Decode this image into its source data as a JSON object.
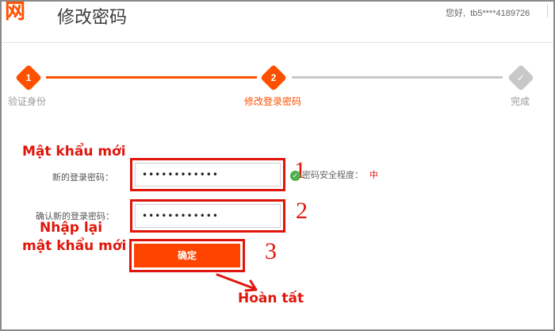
{
  "header": {
    "logo": "网",
    "title": "修改密码",
    "greeting": "您好,",
    "username": "tb5****4189726"
  },
  "steps": [
    {
      "number": "1",
      "label": "验证身份",
      "state": "done"
    },
    {
      "number": "2",
      "label": "修改登录密码",
      "state": "active"
    },
    {
      "number": "✓",
      "label": "完成",
      "state": "pending"
    }
  ],
  "form": {
    "new_password_label": "新的登录密码：",
    "new_password_value": "••••••••••••",
    "confirm_password_label": "确认新的登录密码：",
    "confirm_password_value": "••••••••••••",
    "strength_label": "密码安全程度：",
    "strength_level": "中",
    "submit_label": "确定"
  },
  "annotations": {
    "new_password": "Mật khẩu mới",
    "reenter_line1": "Nhập lại",
    "reenter_line2": "mật khẩu mới",
    "done": "Hoàn tất",
    "num1": "1",
    "num2": "2",
    "num3": "3"
  },
  "colors": {
    "accent": "#ff5000",
    "annotation_red": "#e0160c",
    "inactive_gray": "#c8c8c8",
    "success_green": "#4cae4c"
  },
  "icons": {
    "strength_check": "check-circle-icon",
    "step_complete": "checkmark-icon"
  }
}
